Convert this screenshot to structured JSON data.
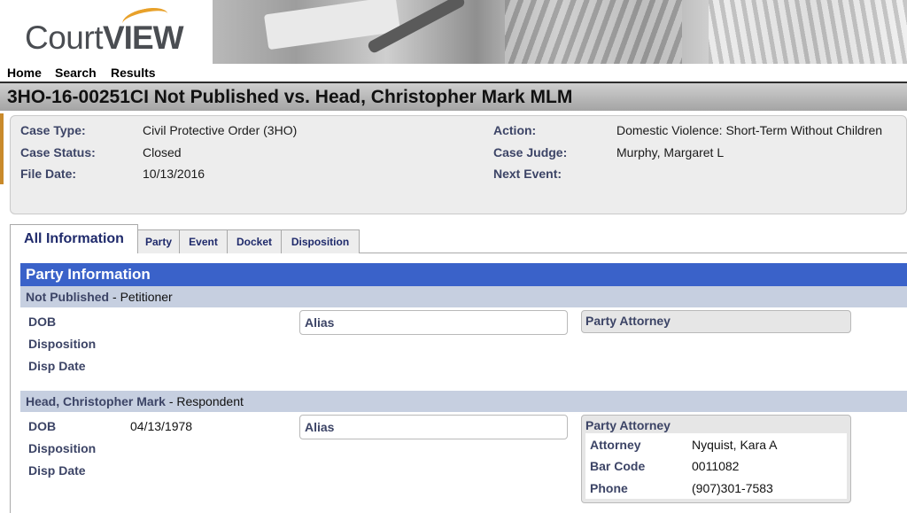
{
  "brand": {
    "logo_prefix": "Court",
    "logo_suffix": "VIEW"
  },
  "nav": {
    "home": "Home",
    "search": "Search",
    "results": "Results"
  },
  "case": {
    "title": "3HO-16-00251CI Not Published vs. Head, Christopher Mark MLM",
    "fields_left": [
      {
        "label": "Case Type:",
        "value": "Civil Protective Order (3HO)"
      },
      {
        "label": "Case Status:",
        "value": "Closed"
      },
      {
        "label": "File Date:",
        "value": "10/13/2016"
      }
    ],
    "fields_right": [
      {
        "label": "Action:",
        "value": "Domestic Violence: Short-Term Without Children"
      },
      {
        "label": "Case Judge:",
        "value": "Murphy, Margaret L"
      },
      {
        "label": "Next Event:",
        "value": ""
      }
    ]
  },
  "tabs": [
    "All Information",
    "Party",
    "Event",
    "Docket",
    "Disposition"
  ],
  "party_section": {
    "title": "Party Information",
    "parties": [
      {
        "name": "Not Published",
        "role": " - Petitioner",
        "dob_label": "DOB",
        "dob": "",
        "disposition_label": "Disposition",
        "disp_date_label": "Disp Date",
        "alias_label": "Alias",
        "attorney_label": "Party Attorney"
      },
      {
        "name": "Head, Christopher Mark",
        "role": " - Respondent",
        "dob_label": "DOB",
        "dob": "04/13/1978",
        "disposition_label": "Disposition",
        "disp_date_label": "Disp Date",
        "alias_label": "Alias",
        "attorney_label": "Party Attorney",
        "attorney": {
          "attorney_label": "Attorney",
          "attorney_value": "Nyquist, Kara A",
          "bar_label": "Bar Code",
          "bar_value": "0011082",
          "phone_label": "Phone",
          "phone_value": "(907)301-7583"
        }
      }
    ]
  },
  "colors": {
    "section_header": "#3a62c9",
    "party_header": "#c6cfe0",
    "label": "#3c4466",
    "accent": "#e8a12a"
  }
}
